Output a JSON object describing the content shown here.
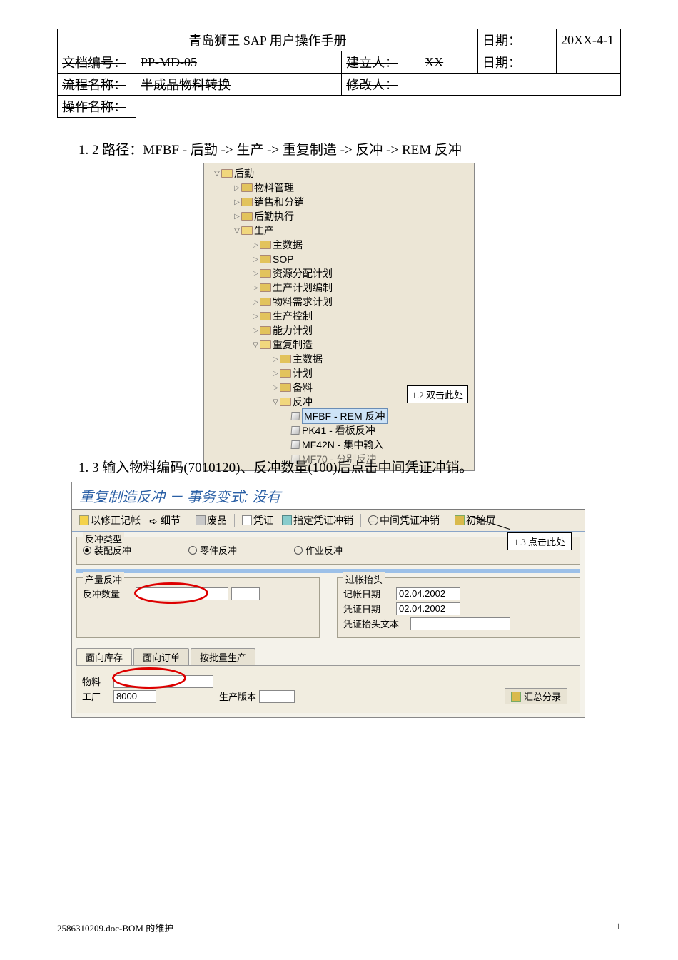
{
  "header": {
    "title": "青岛狮王 SAP 用户操作手册",
    "doc_no_label": "文档编号：",
    "doc_no": "PP-MD-05",
    "creator_label": "建立人：",
    "creator": "XX",
    "date_label": "日期：",
    "date_value": "20XX-4-1",
    "flow_label": "流程名称：",
    "flow": "半成品物料转换",
    "modifier_label": "修改人：",
    "date_label2": "日期：",
    "op_label": "操作名称："
  },
  "para_1_2": "1. 2 路径：MFBF - 后勤 -> 生产 -> 重复制造 -> 反冲 -> REM 反冲",
  "tree": {
    "n0": "后勤",
    "n1": "物料管理",
    "n2": "销售和分销",
    "n3": "后勤执行",
    "n4": "生产",
    "n5": "主数据",
    "n6": "SOP",
    "n7": "资源分配计划",
    "n8": "生产计划编制",
    "n9": "物料需求计划",
    "n10": "生产控制",
    "n11": "能力计划",
    "n12": "重复制造",
    "n13": "主数据",
    "n14": "计划",
    "n15": "备料",
    "n16": "反冲",
    "leaf1": "MFBF - REM 反冲",
    "leaf2": "PK41 - 看板反冲",
    "leaf3": "MF42N - 集中输入",
    "leaf4": "MF70 - 分别反冲",
    "callout": "1.2  双击此处"
  },
  "para_1_3": "1. 3 输入物料编码(7010120)、反冲数量(100)后点击中间凭证冲销。",
  "sap": {
    "title": "重复制造反冲 － 事务变式: 没有",
    "toolbar": {
      "b1": "以修正记帐",
      "b2": "细节",
      "b3": "废品",
      "b4": "凭证",
      "b5": "指定凭证冲销",
      "b6": "中间凭证冲销",
      "b7": "初始屏"
    },
    "group1_title": "反冲类型",
    "r1": "装配反冲",
    "r2": "零件反冲",
    "r3": "作业反冲",
    "panel_left_title": "产量反冲",
    "fl_qty": "反冲数量",
    "panel_right_title": "过帐抬头",
    "fr_post_date_l": "记帐日期",
    "fr_post_date_v": "02.04.2002",
    "fr_doc_date_l": "凭证日期",
    "fr_doc_date_v": "02.04.2002",
    "fr_head_l": "凭证抬头文本",
    "tab1": "面向库存",
    "tab2": "面向订单",
    "tab3": "按批量生产",
    "lw_mat_l": "物料",
    "lw_plant_l": "工厂",
    "lw_plant_v": "8000",
    "lw_ver_l": "生产版本",
    "hz_btn": "汇总分录",
    "callout2": "1.3  点击此处"
  },
  "footer": {
    "left": "2586310209.doc-BOM 的维护",
    "right": "1"
  }
}
